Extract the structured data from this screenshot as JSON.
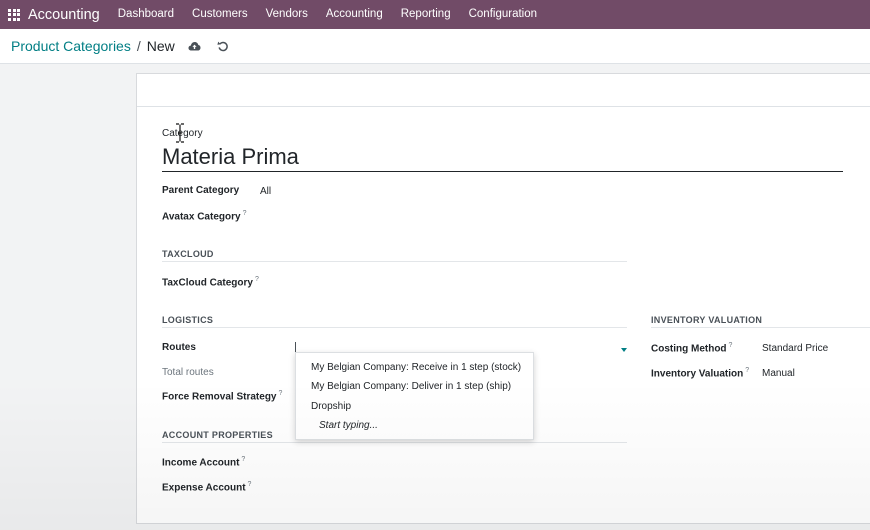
{
  "navbar": {
    "app_name": "Accounting",
    "menus": [
      "Dashboard",
      "Customers",
      "Vendors",
      "Accounting",
      "Reporting",
      "Configuration"
    ]
  },
  "breadcrumb": {
    "parent": "Product Categories",
    "separator": "/",
    "current": "New",
    "icons": [
      "cloud-upload-icon",
      "discard-icon"
    ]
  },
  "form": {
    "category_label": "Category",
    "category_name": "Materia Prima",
    "parent_category": {
      "label": "Parent Category",
      "value": "All"
    },
    "avatax_category": {
      "label": "Avatax Category",
      "help": "?"
    },
    "taxcloud": {
      "title": "TAXCLOUD",
      "category": {
        "label": "TaxCloud Category",
        "help": "?"
      }
    },
    "logistics": {
      "title": "LOGISTICS",
      "routes_label": "Routes",
      "total_routes_label": "Total routes",
      "removal_strategy": {
        "label": "Force Removal Strategy",
        "help": "?"
      },
      "route_options": [
        "My Belgian Company: Receive in 1 step (stock)",
        "My Belgian Company: Deliver in 1 step (ship)",
        "Dropship"
      ],
      "route_more": "Start typing..."
    },
    "inventory_valuation": {
      "title": "INVENTORY VALUATION",
      "costing_method": {
        "label": "Costing Method",
        "help": "?",
        "value": "Standard Price"
      },
      "valuation": {
        "label": "Inventory Valuation",
        "help": "?",
        "value": "Manual"
      }
    },
    "account_properties": {
      "title": "ACCOUNT PROPERTIES",
      "income": {
        "label": "Income Account",
        "help": "?"
      },
      "expense": {
        "label": "Expense Account",
        "help": "?"
      }
    }
  },
  "colors": {
    "navbar": "#714b67",
    "link": "#017e84",
    "text": "#212529"
  }
}
